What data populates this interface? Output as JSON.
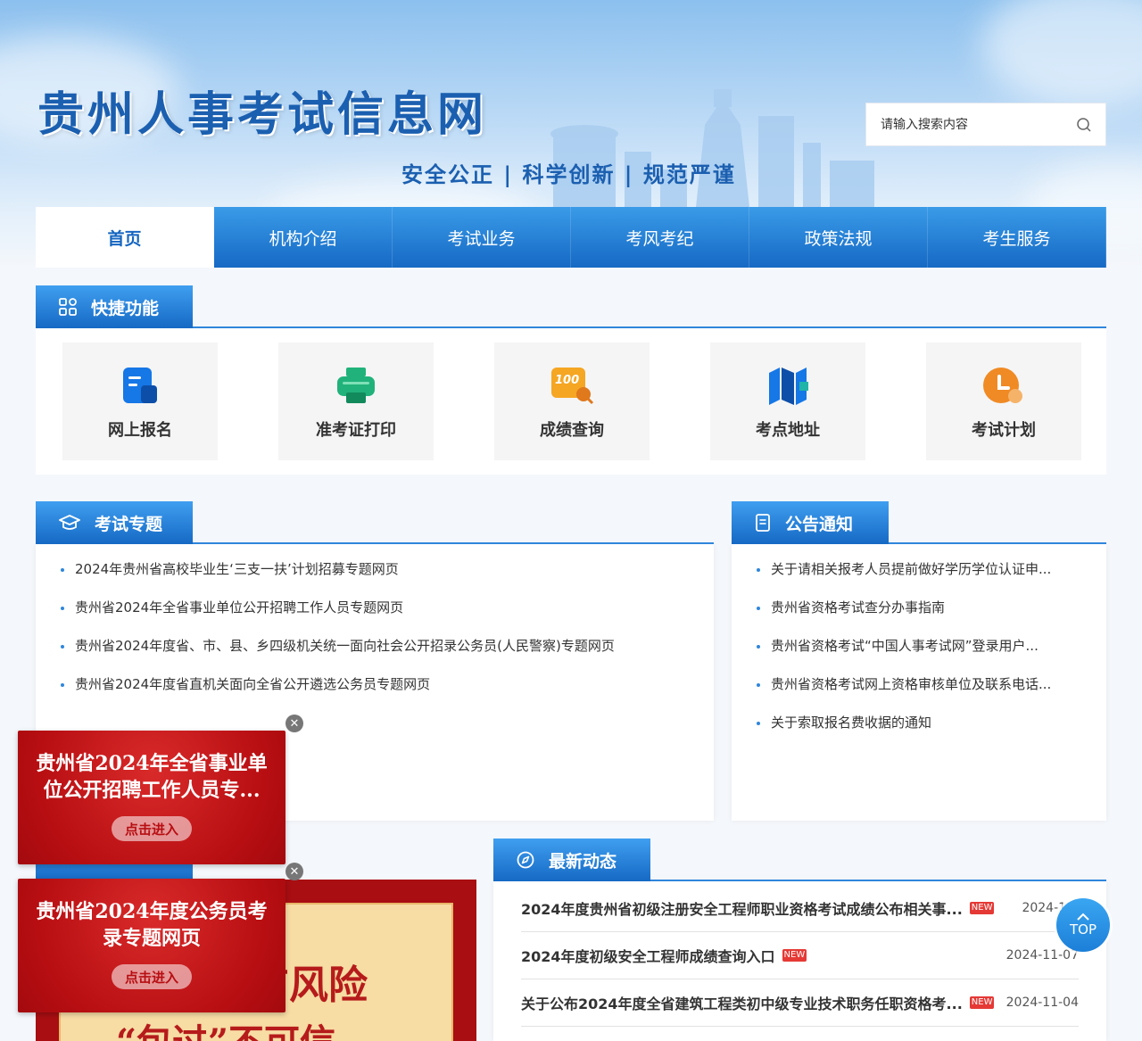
{
  "header": {
    "site_title": "贵州人事考试信息网",
    "slogan": "安全公正 | 科学创新 | 规范严谨",
    "search_placeholder": "请输入搜索内容"
  },
  "nav": [
    "首页",
    "机构介绍",
    "考试业务",
    "考风考纪",
    "政策法规",
    "考生服务"
  ],
  "nav_active": "首页",
  "quick": {
    "title": "快捷功能",
    "items": [
      {
        "label": "网上报名",
        "icon": "form-icon",
        "color": "#1677e6"
      },
      {
        "label": "准考证打印",
        "icon": "printer-icon",
        "color": "#20b27a"
      },
      {
        "label": "成绩查询",
        "icon": "score-100-icon",
        "color": "#f5a623"
      },
      {
        "label": "考点地址",
        "icon": "map-icon",
        "color": "#1677e6"
      },
      {
        "label": "考试计划",
        "icon": "clock-icon",
        "color": "#f08a24"
      }
    ]
  },
  "topics": {
    "title": "考试专题",
    "items": [
      "2024年贵州省高校毕业生‘三支一扶’计划招募专题网页",
      "贵州省2024年全省事业单位公开招聘工作人员专题网页",
      "贵州省2024年度省、市、县、乡四级机关统一面向社会公开招录公务员(人民警察)专题网页",
      "贵州省2024年度省直机关面向全省公开遴选公务员专题网页"
    ]
  },
  "notices": {
    "title": "公告通知",
    "items": [
      "关于请相关报考人员提前做好学历学位认证申...",
      "贵州省资格考试查分办事指南",
      "贵州省资格考试“中国人事考试网”登录用户...",
      "贵州省资格考试网上资格审核单位及联系电话...",
      "关于索取报名费收据的通知"
    ]
  },
  "news": {
    "title": "最新动态",
    "new_badge": "NEW",
    "items": [
      {
        "title": "2024年度贵州省初级注册安全工程师职业资格考试成绩公布相关事...",
        "date": "2024-11-"
      },
      {
        "title": "2024年度初级安全工程师成绩查询入口",
        "date": "2024-11-07"
      },
      {
        "title": "关于公布2024年度全省建筑工程类初中级专业技术职务任职资格考...",
        "date": "2024-11-04"
      }
    ]
  },
  "float_ads": [
    {
      "title": "贵州省2024年全省事业单位公开招聘工作人员专...",
      "button": "点击进入"
    },
    {
      "title": "贵州省2024年度公务员考录专题网页",
      "button": "点击进入"
    }
  ],
  "banner": {
    "line1": "有风险",
    "line2": "“包过”不可信"
  },
  "top_button": "TOP",
  "colors": {
    "primary": "#1669c4",
    "accent_red": "#b70e12",
    "badge_red": "#e53935"
  }
}
